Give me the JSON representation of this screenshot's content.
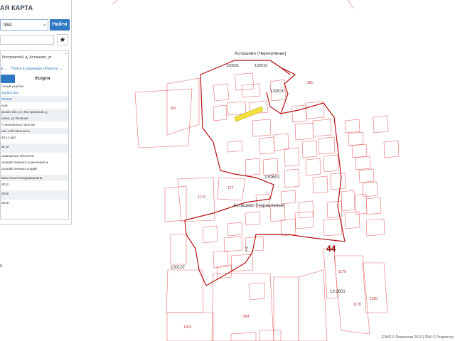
{
  "app": {
    "title": "АЯ КАРТА"
  },
  "search": {
    "value": ":384",
    "clear_glyph": "×",
    "button_label": "Найти"
  },
  "toolbar": {
    "star_glyph": "★"
  },
  "object": {
    "address": "Костромской, д. Асташево, ул",
    "collapse_glyph": "⌃",
    "link_left": "и →",
    "link_right": "Поиск в границах объекта →",
    "tab_services": "Услуги",
    "rows": [
      "льный участок",
      "130601:384",
      "130601",
      "ный",
      "мская обл, р-н Костромской, д",
      "шево, ул Зеленая",
      "т населённых пунктов",
      "ная собственность",
      "83,11 руб",
      "кв. м",
      "азмещения объектов",
      "охозяйственного назначения и",
      "охозяйственных угодий",
      "вина Ольга Владимировна",
      "2012",
      "2018",
      "2018"
    ]
  },
  "sidebar": {
    "zoom_value": "0"
  },
  "map": {
    "labels": {
      "village_top": "Асташево (Черноленье)",
      "village_mid": "Асташево (Черноленье)",
      "q_top": "130601",
      "q_top2": "132610",
      "q_mid": "130601",
      "q_right": "132610",
      "q_bottom": "13:2601",
      "q_left": "130107",
      "parcel_7": "7",
      "big_44": "44",
      "p177": "177",
      "p1173": "1173",
      "p951": "951",
      "p381": "381",
      "p954": "954",
      "p1004": "1004",
      "p1179": "1179",
      "p1178": "1178",
      "p1180": "1180"
    },
    "colors": {
      "parcel": "#e26a6a",
      "boundary": "#b41212",
      "highlight": "#f0e040"
    }
  },
  "footer": {
    "credits": "ЕЭКО © Росреестр 2010 | ПКК © Росреестр"
  }
}
